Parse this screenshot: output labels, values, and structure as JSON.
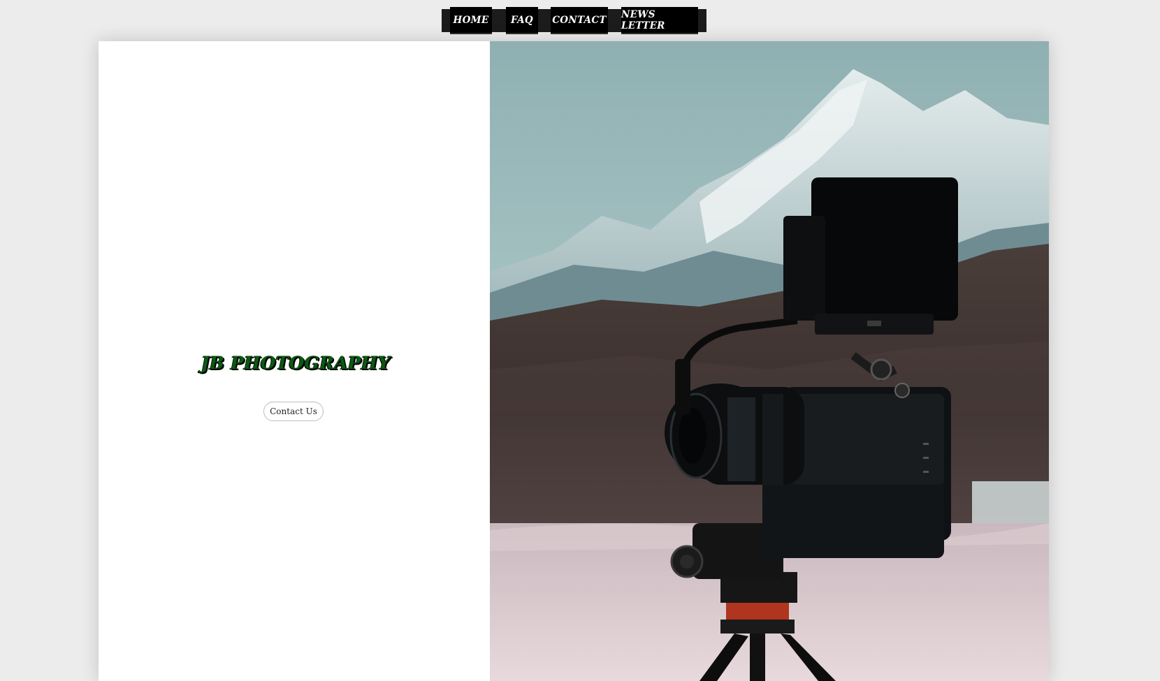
{
  "nav": {
    "items": [
      {
        "label": "HOME"
      },
      {
        "label": "FAQ"
      },
      {
        "label": "CONTACT"
      },
      {
        "label": "NEWS LETTER"
      }
    ]
  },
  "hero": {
    "title": "JB PHOTOGRAPHY",
    "cta_label": "Contact Us",
    "image_subject": "camera-on-tripod-mountain-photo"
  },
  "colors": {
    "page_background": "#ececec",
    "nav_background": "#000000",
    "nav_text": "#ffffff",
    "title_color": "#0a5a12",
    "card_background": "#ffffff"
  }
}
